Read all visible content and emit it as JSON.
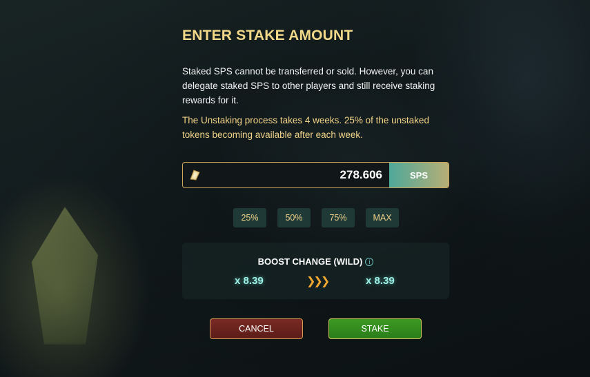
{
  "dialog": {
    "title": "ENTER STAKE AMOUNT",
    "description": "Staked SPS cannot be transferred or sold. However, you can delegate staked SPS to other players and still receive staking rewards for it.",
    "warning": "The Unstaking process takes 4 weeks. 25% of the unstaked tokens becoming available after each week."
  },
  "amount": {
    "value": "278.606",
    "token": "SPS",
    "icon": "sps-token-icon"
  },
  "percent_buttons": [
    "25%",
    "50%",
    "75%",
    "MAX"
  ],
  "boost": {
    "title": "BOOST CHANGE (WILD)",
    "from": "x 8.39",
    "to": "x 8.39",
    "arrow_icon": "triple-chevron-right-icon",
    "info_icon": "info-icon"
  },
  "actions": {
    "cancel": "CANCEL",
    "stake": "STAKE"
  },
  "colors": {
    "title": "#f2d98a",
    "warning": "#f3d58a",
    "boost_value": "#9cf0e6",
    "cancel": "#7a2a24",
    "stake": "#3d9a24"
  }
}
